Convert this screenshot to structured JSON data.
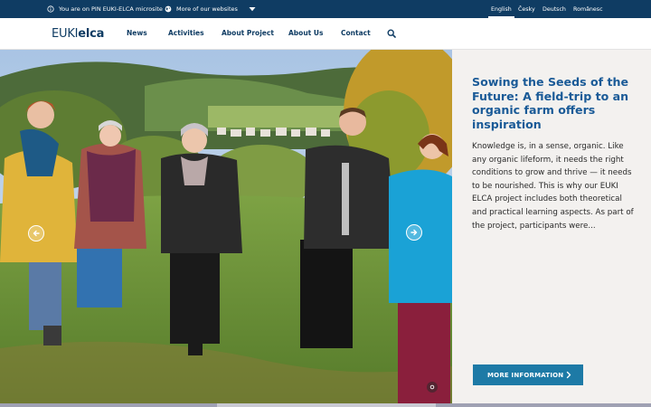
{
  "topbar": {
    "microsite_label": "You are on PIN EUKI-ELCA microsite",
    "websites_label": "More of our websites",
    "languages": [
      "English",
      "Česky",
      "Deutsch",
      "Românesc"
    ],
    "active_language": "English"
  },
  "nav": {
    "logo_thin": "EUKI",
    "logo_bold": "elca",
    "links": [
      "News",
      "Activities",
      "About Project",
      "About Us",
      "Contact"
    ]
  },
  "article": {
    "title": "Sowing the Seeds of the Future: A field-trip to an organic farm offers inspiration",
    "excerpt": "Knowledge is, in a sense, organic. Like any organic lifeform, it needs the right conditions to grow and thrive — it needs to be nourished. This is why our EUKI ELCA project includes both theoretical and practical learning aspects. As part of the project, participants were...",
    "button_label": "MORE INFORMATION"
  },
  "colors": {
    "topbar_bg": "#0f3c63",
    "title_blue": "#1a5a97",
    "button_bg": "#1d7aa6",
    "panel_bg": "#f3f1ef"
  },
  "icons": {
    "microsite": "info-circle-icon",
    "websites": "globe-icon",
    "dropdown": "caret-down-icon",
    "search": "search-icon",
    "prev": "arrow-left-circle-icon",
    "next": "arrow-right-circle-icon",
    "button": "chevron-right-icon"
  }
}
